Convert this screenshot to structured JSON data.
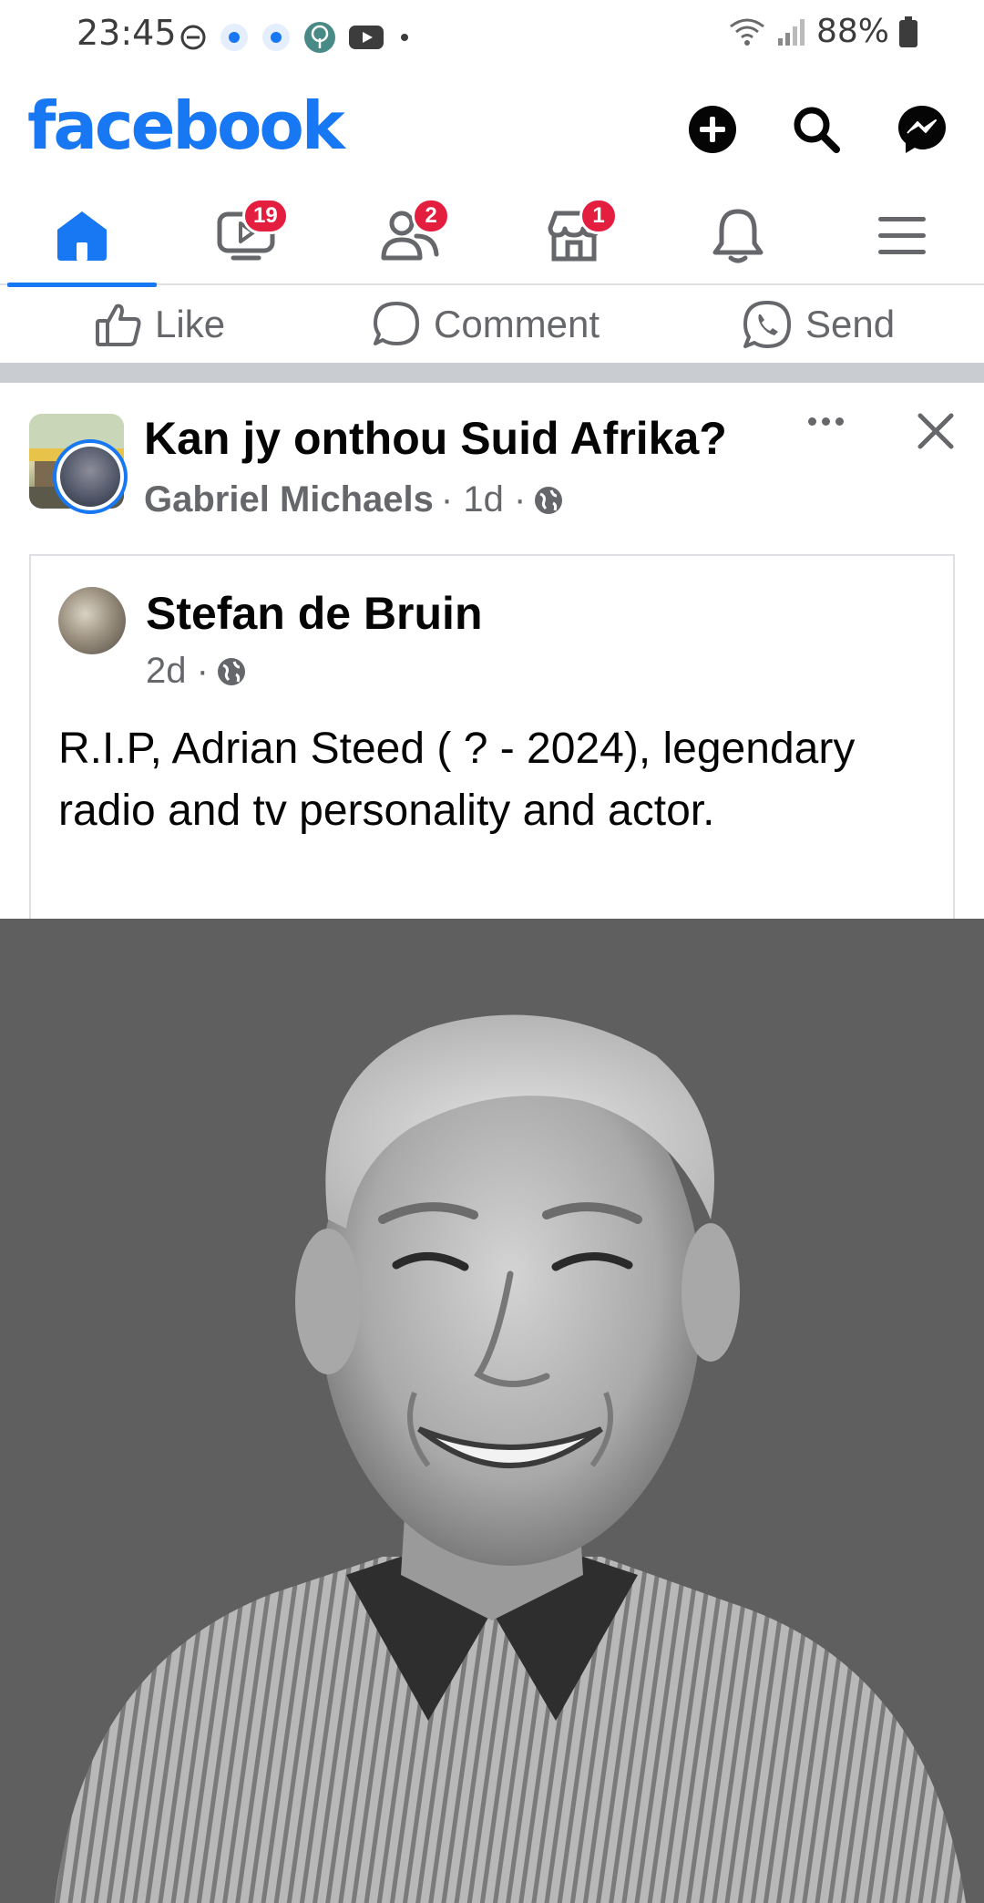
{
  "status_bar": {
    "time": "23:45",
    "battery": "88%",
    "icons": [
      "do-not-disturb-icon",
      "notification-dot-icon",
      "notification-dot-icon",
      "app-tree-icon",
      "youtube-icon",
      "more-dot-icon",
      "wifi-icon",
      "signal-icon",
      "battery-icon"
    ]
  },
  "header": {
    "logo": "facebook",
    "buttons": [
      "create-icon",
      "search-icon",
      "messenger-icon"
    ]
  },
  "nav": {
    "tabs": [
      {
        "name": "home",
        "icon": "home-icon",
        "badge": ""
      },
      {
        "name": "video",
        "icon": "video-icon",
        "badge": "19"
      },
      {
        "name": "friends",
        "icon": "friends-icon",
        "badge": "2"
      },
      {
        "name": "marketplace",
        "icon": "marketplace-icon",
        "badge": "1"
      },
      {
        "name": "notifications",
        "icon": "bell-icon",
        "badge": ""
      },
      {
        "name": "menu",
        "icon": "menu-icon",
        "badge": ""
      }
    ]
  },
  "actions": {
    "like": "Like",
    "comment": "Comment",
    "send": "Send"
  },
  "post": {
    "group": "Kan jy onthou Suid Afrika?",
    "author": "Gabriel Michaels",
    "time": "· 1d ·",
    "shared": {
      "author": "Stefan de Bruin",
      "time": "2d ·",
      "text": "R.I.P, Adrian Steed ( ? - 2024), legendary radio and tv personality and actor."
    }
  },
  "colors": {
    "brand": "#1877f2",
    "badge": "#e41e3f",
    "secondary_text": "#65676b"
  }
}
